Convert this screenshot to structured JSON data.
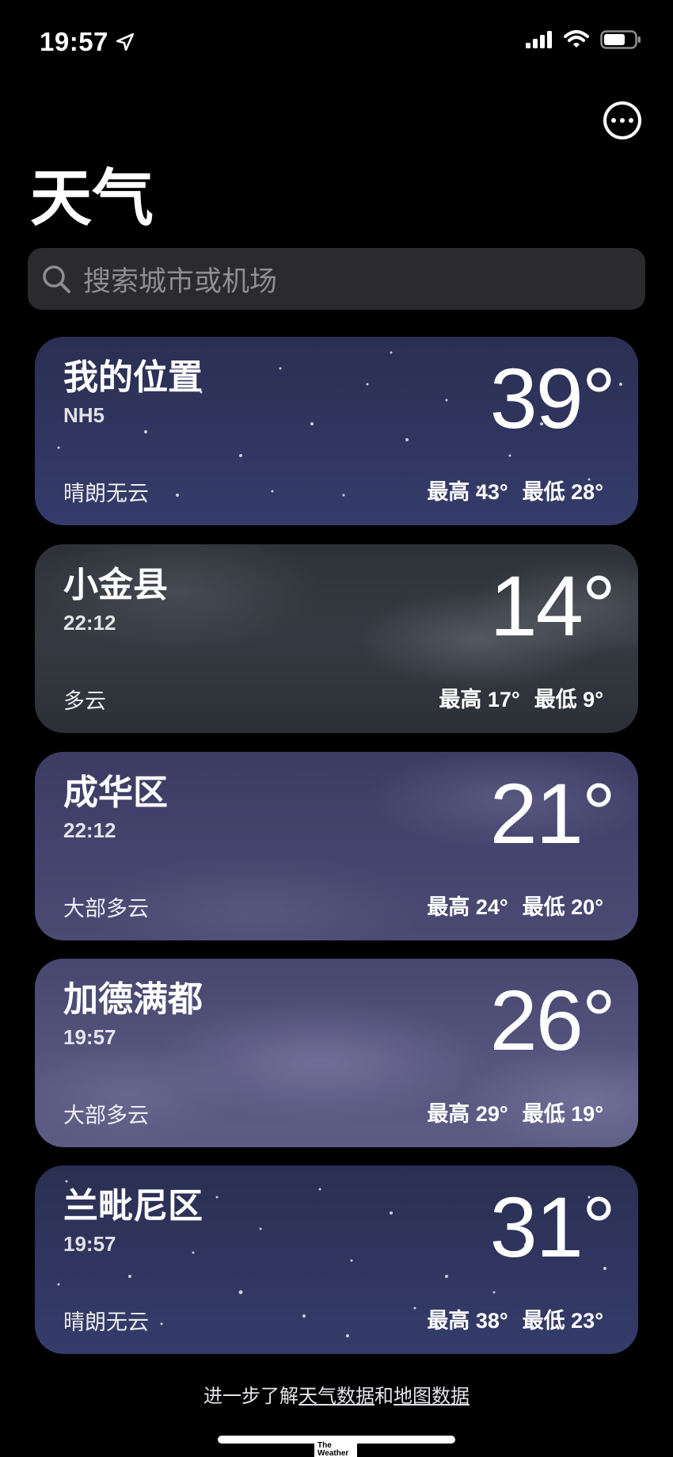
{
  "status_bar": {
    "time": "19:57",
    "location_icon": "location-arrow-icon",
    "signal_icon": "cellular-signal-icon",
    "wifi_icon": "wifi-icon",
    "battery_icon": "battery-icon"
  },
  "header": {
    "more_icon": "ellipsis-circle-icon",
    "title": "天气"
  },
  "search": {
    "placeholder": "搜索城市或机场",
    "icon": "search-icon"
  },
  "cards": [
    {
      "city": "我的位置",
      "sub": "NH5",
      "temp": "39°",
      "condition": "晴朗无云",
      "high": "最高 43°",
      "low": "最低 28°",
      "background": "clear-night"
    },
    {
      "city": "小金县",
      "sub": "22:12",
      "temp": "14°",
      "condition": "多云",
      "high": "最高 17°",
      "low": "最低 9°",
      "background": "cloudy"
    },
    {
      "city": "成华区",
      "sub": "22:12",
      "temp": "21°",
      "condition": "大部多云",
      "high": "最高 24°",
      "low": "最低 20°",
      "background": "mostly-cloudy-night"
    },
    {
      "city": "加德满都",
      "sub": "19:57",
      "temp": "26°",
      "condition": "大部多云",
      "high": "最高 29°",
      "low": "最低 19°",
      "background": "mostly-cloudy-night"
    },
    {
      "city": "兰毗尼区",
      "sub": "19:57",
      "temp": "31°",
      "condition": "晴朗无云",
      "high": "最高 38°",
      "low": "最低 23°",
      "background": "clear-night"
    }
  ],
  "footer": {
    "prefix": "进一步了解",
    "weather_data_link": "天气数据",
    "middle": "和",
    "map_data_link": "地图数据"
  },
  "branding": {
    "logo_text": "The Weather"
  },
  "colors": {
    "background": "#000000",
    "search_bg": "#2b2b2d",
    "placeholder": "#8e8e93",
    "text": "#ffffff"
  }
}
